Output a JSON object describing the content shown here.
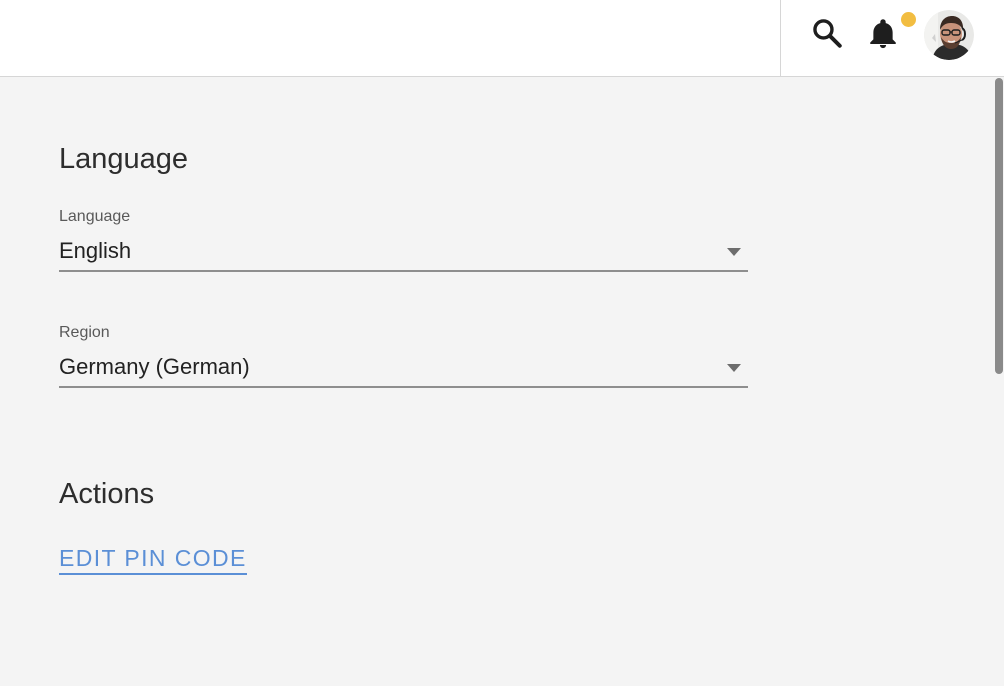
{
  "header": {
    "search_icon": "search-icon",
    "notification_icon": "bell-icon",
    "notification_badge_color": "#f2bd41",
    "avatar_icon": "user-avatar"
  },
  "language_section": {
    "title": "Language",
    "language_field": {
      "label": "Language",
      "value": "English"
    },
    "region_field": {
      "label": "Region",
      "value": "Germany (German)"
    }
  },
  "actions_section": {
    "title": "Actions",
    "edit_pin_label": "EDIT PIN CODE"
  },
  "colors": {
    "link": "#5b8fd6",
    "background": "#f4f4f4",
    "header_background": "#ffffff"
  }
}
